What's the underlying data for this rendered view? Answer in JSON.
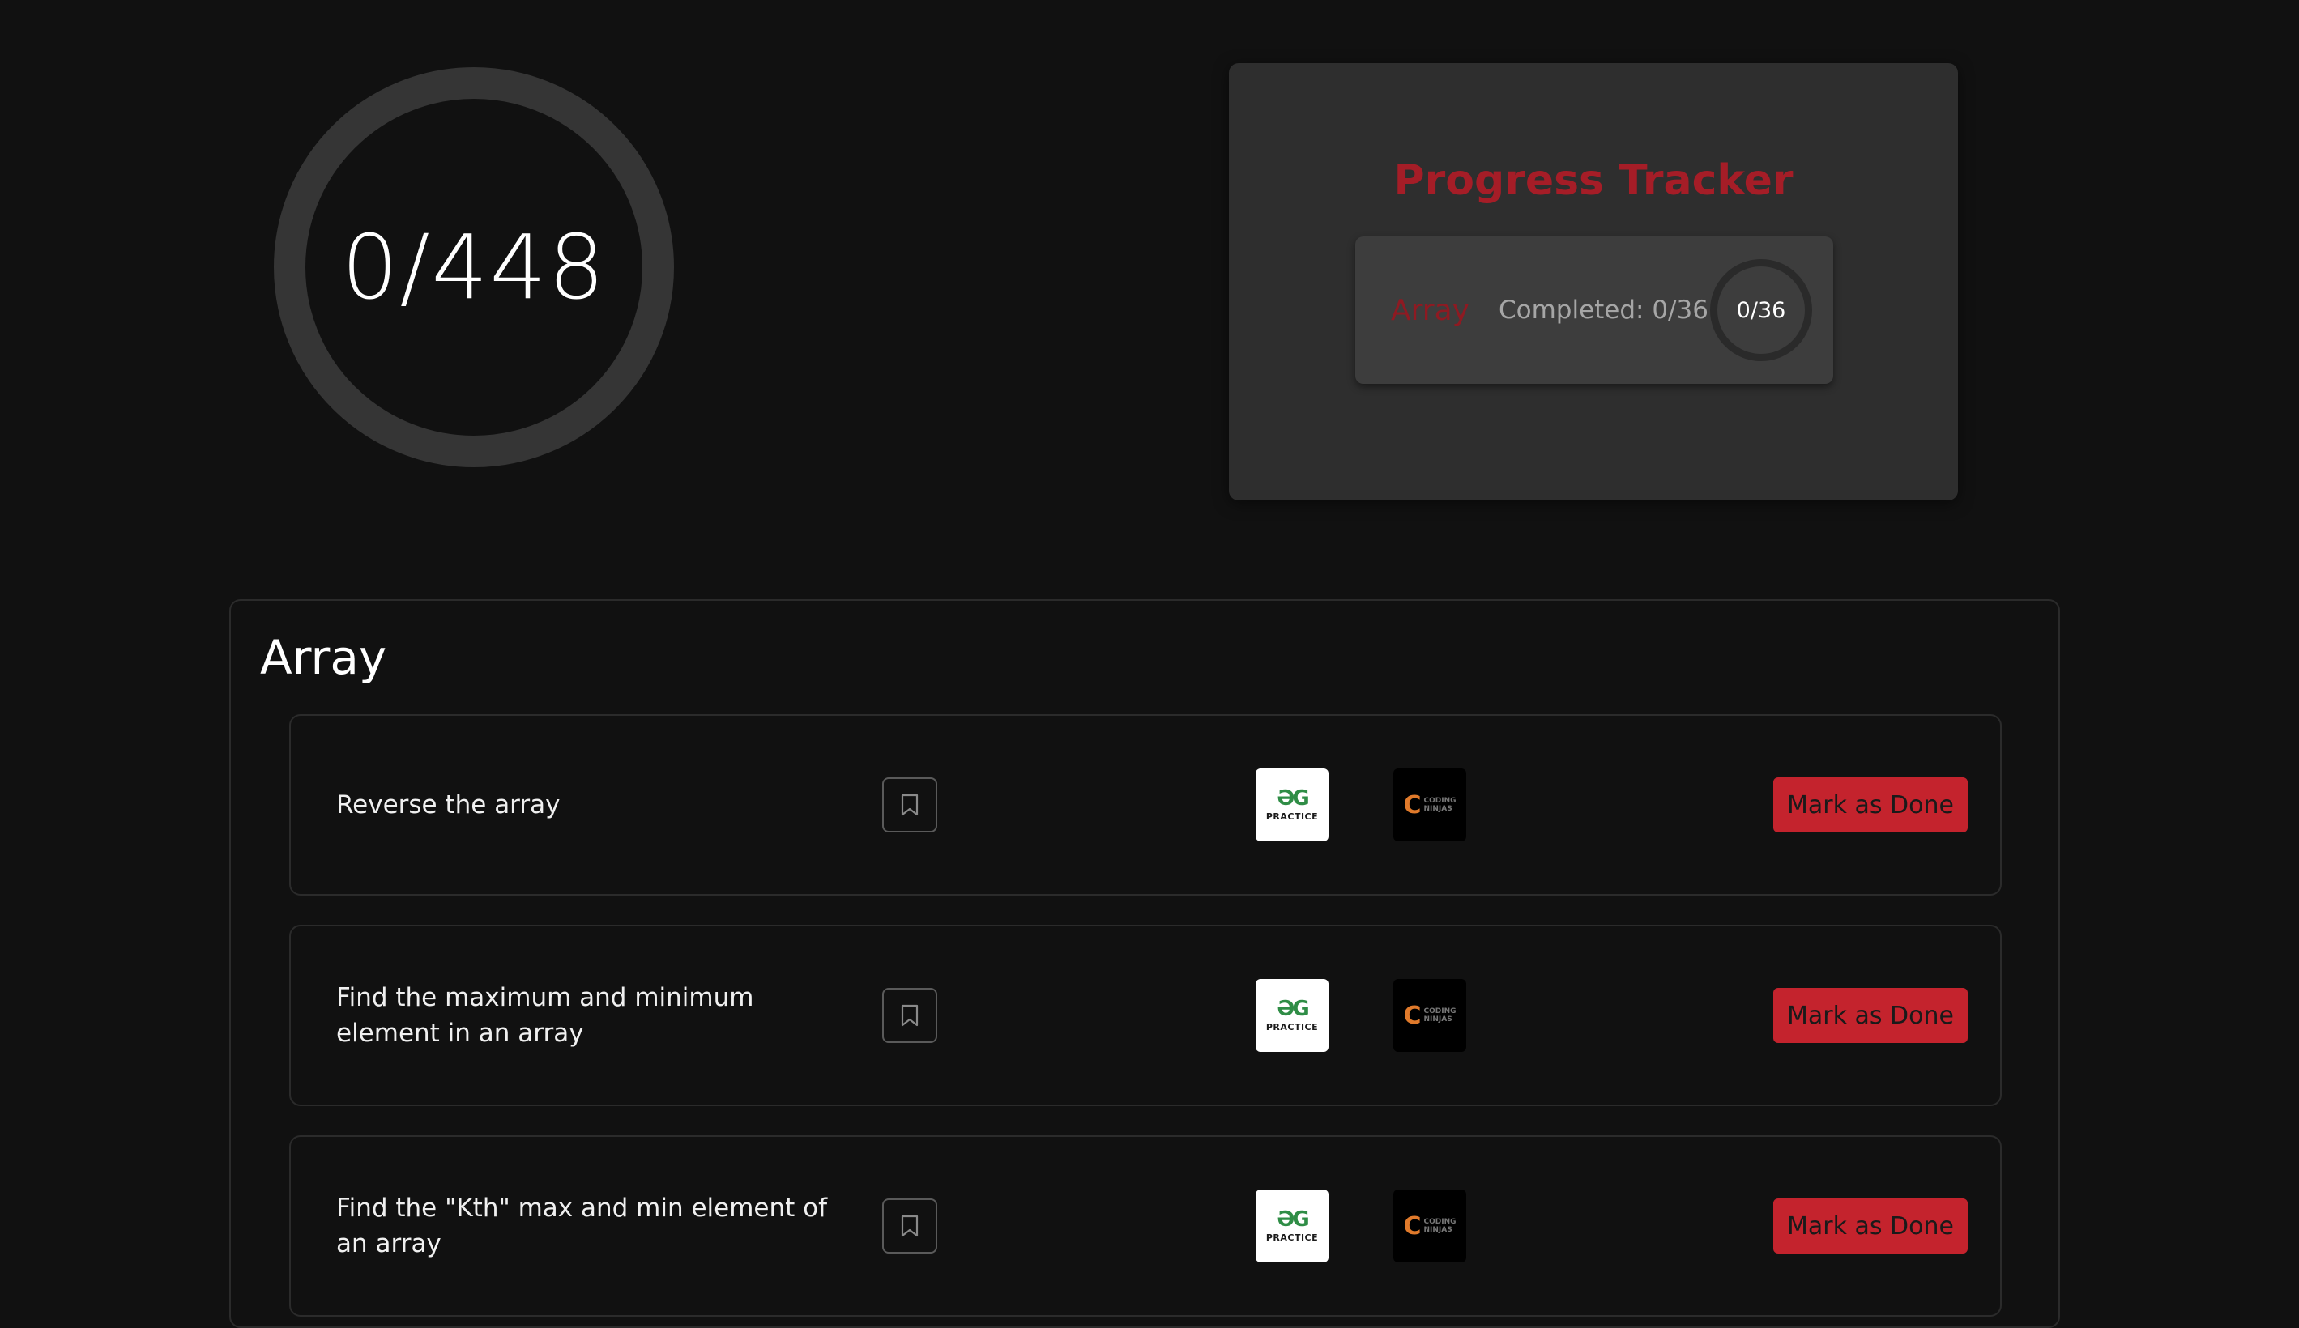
{
  "overall": {
    "progress_text": "0/448"
  },
  "tracker": {
    "title": "Progress Tracker",
    "topics": [
      {
        "name": "Array",
        "completed_text": "Completed: 0/36",
        "ring_text": "0/36"
      }
    ]
  },
  "section": {
    "title": "Array",
    "questions": [
      {
        "text": "Reverse the array",
        "button_label": "Mark as Done"
      },
      {
        "text": "Find the maximum and minimum element in an array",
        "button_label": "Mark as Done"
      },
      {
        "text": "Find the \"Kth\" max and min element of an array",
        "button_label": "Mark as Done"
      }
    ]
  },
  "logos": {
    "gfg_mark": "ƏG",
    "gfg_text": "PRACTICE",
    "cn_mark": "C",
    "cn_text_line1": "CODING",
    "cn_text_line2": "NINJAS"
  },
  "icons": {
    "bookmark": "bookmark-icon"
  },
  "colors": {
    "background": "#111111",
    "accent_red": "#c4232d",
    "title_red": "#a51d27",
    "card_bg": "#2e2e2e",
    "gfg_green": "#2f8d46",
    "cn_orange": "#e07a2b"
  }
}
